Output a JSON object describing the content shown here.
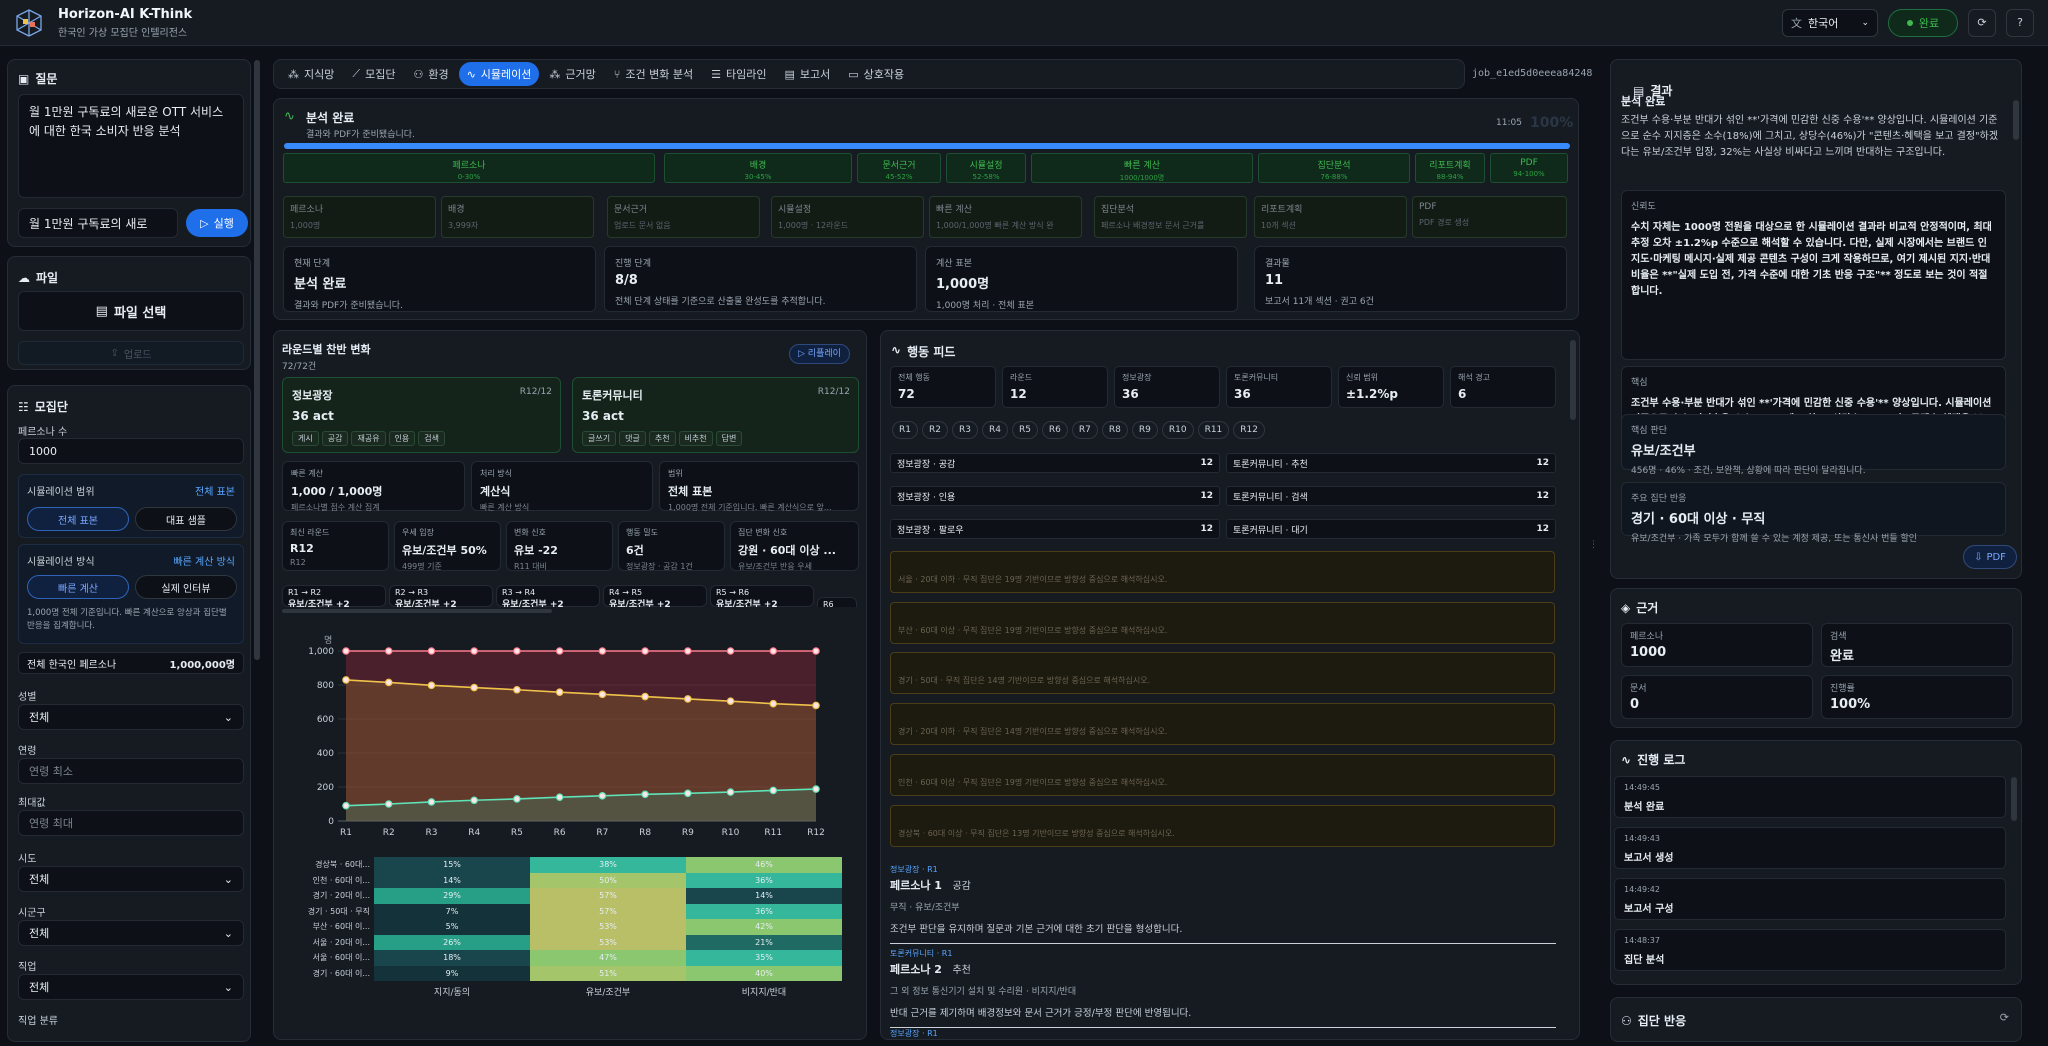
{
  "app": {
    "title": "Horizon-AI K-Think",
    "subtitle": "한국인 가상 모집단 인텔리전스",
    "lang": "한국어",
    "status": "완료",
    "job_id": "job_e1ed5d0eeea84248"
  },
  "left": {
    "question_title": "질문",
    "question_text": "월 1만원 구독료의 새로운 OTT 서비스에 대한 한국 소비자 반응 분석",
    "question_input": "월 1만원 구독료의 새로",
    "run_label": "실행",
    "file_title": "파일",
    "file_select": "파일 선택",
    "upload": "업로드",
    "pop_title": "모집단",
    "persona_count_label": "페르소나 수",
    "persona_count": "1000",
    "sim_range_label": "시뮬레이션 범위",
    "sim_range_value": "전체 표본",
    "range_opts": [
      "전체 표본",
      "대표 샘플"
    ],
    "sim_method_label": "시뮬레이션 방식",
    "sim_method_value": "빠른 계산 방식",
    "method_opts": [
      "빠른 계산",
      "실제 인터뷰"
    ],
    "method_note": "1,000명 전체 기준입니다. 빠른 계산으로 앙상과 집단별 반응을 집계합니다.",
    "total_label": "전체 한국인 페르소나",
    "total_value": "1,000,000명",
    "gender_label": "성별",
    "gender": "전체",
    "age_label": "연령",
    "age_min_ph": "연령 최소",
    "max_label": "최대값",
    "age_max_ph": "연령 최대",
    "sido_label": "시도",
    "sido": "전체",
    "sigungu_label": "시군구",
    "sigungu": "전체",
    "job_label": "직업",
    "job": "전체",
    "jobcat_label": "직업 분류"
  },
  "tabs": [
    "지식망",
    "모집단",
    "환경",
    "시뮬레이션",
    "근거망",
    "조건 변화 분석",
    "타임라인",
    "보고서",
    "상호작용"
  ],
  "status": {
    "title": "분석 완료",
    "desc": "결과와 PDF가 준비됐습니다.",
    "time": "11:05",
    "pct": "100%",
    "stages": [
      {
        "name": "페르소나",
        "range": "0-30%"
      },
      {
        "name": "배경",
        "range": "30-45%"
      },
      {
        "name": "문서근거",
        "range": "45-52%"
      },
      {
        "name": "시뮬설정",
        "range": "52-58%"
      },
      {
        "name": "빠른 계산",
        "range": "1000/1000명"
      },
      {
        "name": "집단분석",
        "range": "76-88%"
      },
      {
        "name": "리포트계획",
        "range": "88-94%"
      },
      {
        "name": "PDF",
        "range": "94-100%"
      }
    ],
    "details": [
      {
        "name": "페르소나",
        "d": "1,000명"
      },
      {
        "name": "배경",
        "d": "3,999자"
      },
      {
        "name": "문서근거",
        "d": "업로드 문서 없음"
      },
      {
        "name": "시뮬설정",
        "d": "1,000명 · 12라운드"
      },
      {
        "name": "빠른 계산",
        "d": "1,000/1,000명 빠른 계산 방식 완"
      },
      {
        "name": "집단분석",
        "d": "페르소나 배경정보 문서 근거를"
      },
      {
        "name": "리포트계획",
        "d": "10개 섹션"
      },
      {
        "name": "PDF",
        "d": "PDF 경로 생성"
      }
    ],
    "info": [
      {
        "k": "현재 단계",
        "v": "분석 완료",
        "d": "결과와 PDF가 준비됐습니다."
      },
      {
        "k": "진행 단계",
        "v": "8/8",
        "d": "전체 단계 상태를 기준으로 산출물 완성도를 추적합니다."
      },
      {
        "k": "계산 표본",
        "v": "1,000명",
        "d": "1,000명 처리 · 전체 표본"
      },
      {
        "k": "결과물",
        "v": "11",
        "d": "보고서 11개 섹션 · 권고 6건"
      }
    ]
  },
  "rounds": {
    "title": "라운드별 찬반 변화",
    "sub": "72/72건",
    "replay": "리플레이",
    "plaza": {
      "name": "정보광장",
      "round": "R12/12",
      "act": "36 act",
      "chips": [
        "게시",
        "공감",
        "재공유",
        "인용",
        "검색"
      ]
    },
    "forum": {
      "name": "토론커뮤니티",
      "round": "R12/12",
      "act": "36 act",
      "chips": [
        "글쓰기",
        "댓글",
        "추천",
        "비추천",
        "답변"
      ]
    },
    "calc": [
      {
        "k": "빠른 계산",
        "v": "1,000 / 1,000명",
        "d": "페르소나별 점수 계산 집계"
      },
      {
        "k": "처리 방식",
        "v": "계산식",
        "d": "빠른 계산 방식"
      },
      {
        "k": "범위",
        "v": "전체 표본",
        "d": "1,000명 전체 기준입니다. 빠른 계산식으로 앞..."
      }
    ],
    "stats": [
      {
        "k": "최신 라운드",
        "v": "R12",
        "d": "R12"
      },
      {
        "k": "우세 입장",
        "v": "유보/조건부 50%",
        "d": "499명 기준"
      },
      {
        "k": "변화 신호",
        "v": "유보 -22",
        "d": "R11 대비"
      },
      {
        "k": "행동 밀도",
        "v": "6건",
        "d": "정보광장 · 공감 1건"
      },
      {
        "k": "집단 변화 신호",
        "v": "강원 · 60대 이상 ...",
        "d": "유보/조건부 반응 우세"
      }
    ],
    "trans": [
      {
        "t": "R1 → R2",
        "v": "유보/조건부 +2"
      },
      {
        "t": "R2 → R3",
        "v": "유보/조건부 +2"
      },
      {
        "t": "R3 → R4",
        "v": "유보/조건부 +2"
      },
      {
        "t": "R4 → R5",
        "v": "유보/조건부 +2"
      },
      {
        "t": "R5 → R6",
        "v": "유보/조건부 +2"
      },
      {
        "t": "R6",
        "v": ""
      }
    ]
  },
  "chart_data": [
    {
      "type": "area",
      "ylabel": "명",
      "ylim": [
        0,
        1000
      ],
      "yticks": [
        "0",
        "200",
        "400",
        "600",
        "800",
        "1,000"
      ],
      "categories": [
        "R1",
        "R2",
        "R3",
        "R4",
        "R5",
        "R6",
        "R7",
        "R8",
        "R9",
        "R10",
        "R11",
        "R12"
      ],
      "series": [
        {
          "name": "지지/동의",
          "color": "#5fe3b8",
          "values": [
            90,
            100,
            112,
            122,
            130,
            140,
            148,
            157,
            163,
            170,
            180,
            188
          ]
        },
        {
          "name": "유보/조건부",
          "color": "#f0c24a",
          "values": [
            830,
            815,
            798,
            785,
            772,
            758,
            745,
            732,
            718,
            705,
            690,
            680
          ]
        },
        {
          "name": "비지지/반대",
          "color": "#ff7b8b",
          "values": [
            1000,
            1000,
            1000,
            1000,
            1000,
            1000,
            1000,
            1000,
            1000,
            1000,
            1000,
            1000
          ]
        }
      ],
      "legend": "bottom"
    },
    {
      "type": "heatmap",
      "rows": [
        "경상북 · 60대...",
        "인천 · 60대 이...",
        "경기 · 20대 이...",
        "경기 · 50대 · 무직",
        "부산 · 60대 이...",
        "서울 · 20대 이...",
        "서울 · 60대 이...",
        "경기 · 60대 이..."
      ],
      "columns": [
        "지지/동의",
        "유보/조건부",
        "비지지/반대"
      ],
      "values": [
        [
          15,
          38,
          46
        ],
        [
          14,
          50,
          36
        ],
        [
          29,
          57,
          14
        ],
        [
          7,
          57,
          36
        ],
        [
          5,
          53,
          42
        ],
        [
          26,
          53,
          21
        ],
        [
          18,
          47,
          35
        ],
        [
          9,
          51,
          40
        ]
      ]
    }
  ],
  "feed": {
    "title": "행동 피드",
    "stats": [
      {
        "k": "전체 행동",
        "v": "72"
      },
      {
        "k": "라운드",
        "v": "12"
      },
      {
        "k": "정보광장",
        "v": "36"
      },
      {
        "k": "토론커뮤니티",
        "v": "36"
      },
      {
        "k": "신뢰 범위",
        "v": "±1.2%p"
      },
      {
        "k": "해석 경고",
        "v": "6"
      }
    ],
    "rounds": [
      "R1",
      "R2",
      "R3",
      "R4",
      "R5",
      "R6",
      "R7",
      "R8",
      "R9",
      "R10",
      "R11",
      "R12"
    ],
    "breakdown": [
      {
        "l": "정보광장 · 공감",
        "v": "12"
      },
      {
        "l": "토론커뮤니티 · 추천",
        "v": "12"
      },
      {
        "l": "정보광장 · 인용",
        "v": "12"
      },
      {
        "l": "토론커뮤니티 · 검색",
        "v": "12"
      },
      {
        "l": "정보광장 · 팔로우",
        "v": "12"
      },
      {
        "l": "토론커뮤니티 · 대기",
        "v": "12"
      }
    ],
    "warns": [
      "서울 · 20대 이하 · 무직 집단은 19명 기반이므로 방향성 중심으로 해석하십시오.",
      "부산 · 60대 이상 · 무직 집단은 19명 기반이므로 방향성 중심으로 해석하십시오.",
      "경기 · 50대 · 무직 집단은 14명 기반이므로 방향성 중심으로 해석하십시오.",
      "경기 · 20대 이하 · 무직 집단은 14명 기반이므로 방향성 중심으로 해석하십시오.",
      "인천 · 60대 이상 · 무직 집단은 19명 기반이므로 방향성 중심으로 해석하십시오.",
      "경상북 · 60대 이상 · 무직 집단은 13명 기반이므로 방향성 중심으로 해석하십시오."
    ],
    "posts": [
      {
        "tag": "정보광장 · R1",
        "who": "페르소나 1",
        "act": "공감",
        "meta": "무직 · 유보/조건부",
        "text": "조건부 판단을 유지하며 질문과 기본 근거에 대한 초기 판단을 형성합니다."
      },
      {
        "tag": "토론커뮤니티 · R1",
        "who": "페르소나 2",
        "act": "추천",
        "meta": "그 외 정보 통신기기 설치 및 수리원 · 비지지/반대",
        "text": "반대 근거를 제기하며 배경정보와 문서 근거가 긍정/부정 판단에 반영됩니다."
      },
      {
        "tag": "정보광장 · R1",
        "who": "",
        "act": "",
        "meta": "",
        "text": ""
      }
    ]
  },
  "result": {
    "title": "결과",
    "head": "분석 완료",
    "summary": "조건부 수용·부분 반대가 섞인 **'가격에 민감한 신중 수용'** 양상입니다. 시뮬레이션 기준으로 순수 지지층은 소수(18%)에 그치고, 상당수(46%)가 \"콘텐츠·혜택을 보고 결정\"하겠다는 유보/조건부 입장, 32%는 사실상 비싸다고 느끼며 반대하는 구조입니다.",
    "trust_label": "신뢰도",
    "trust_text": "수치 자체는 1000명 전원을 대상으로 한 시뮬레이션 결과라 비교적 안정적이며, 최대 추정 오차 ±1.2%p 수준으로 해석할 수 있습니다. 다만, 실제 시장에서는 브랜드 인지도·마케팅 메시지·실제 제공 콘텐츠 구성이 크게 작용하므로, 여기 제시된 지지·반대 비율은 **\"실제 도입 전, 가격 수준에 대한 기초 반응 구조\"** 정도로 보는 것이 적절합니다.",
    "core_label": "핵심",
    "core_text": "조건부 수용·부분 반대가 섞인 **'가격에 민감한 신중 수용'** 양상입니다. 시뮬레이션 기준으로 순수 지지층은 소수(18%)에 그치고, 상당수(46%)가 \"콘텐츠·혜택을 보고 결정\"하겠다는 유보/조건부 입장, 32%는 사실상 비싸다고 느끼며 반대하는 구조입니다.",
    "judge_label": "핵심 판단",
    "judge_v": "유보/조건부",
    "judge_d": "456명 · 46% · 조건, 보완책, 상황에 따라 판단이 달라집니다.",
    "group_label": "주요 집단 반응",
    "group_v": "경기 · 60대 이상 · 무직",
    "group_d": "유보/조건부 · 가족 모두가 함께 쓸 수 있는 계정 제공, 또는 통신사 번들 할인",
    "pdf": "PDF"
  },
  "evidence": {
    "title": "근거",
    "items": [
      {
        "k": "페르소나",
        "v": "1000"
      },
      {
        "k": "검색",
        "v": "완료"
      },
      {
        "k": "문서",
        "v": "0"
      },
      {
        "k": "진행률",
        "v": "100%"
      }
    ]
  },
  "log": {
    "title": "진행 로그",
    "items": [
      {
        "t": "14:49:45",
        "m": "분석 완료"
      },
      {
        "t": "14:49:43",
        "m": "보고서 생성"
      },
      {
        "t": "14:49:42",
        "m": "보고서 구성"
      },
      {
        "t": "14:48:37",
        "m": "집단 분석"
      }
    ]
  },
  "group": {
    "title": "집단 반응"
  },
  "colors": {
    "accent": "#1f6feb",
    "support": "#5fe3b8",
    "hold": "#f0c24a",
    "oppose": "#ff7b8b",
    "ok": "#3fb950"
  }
}
